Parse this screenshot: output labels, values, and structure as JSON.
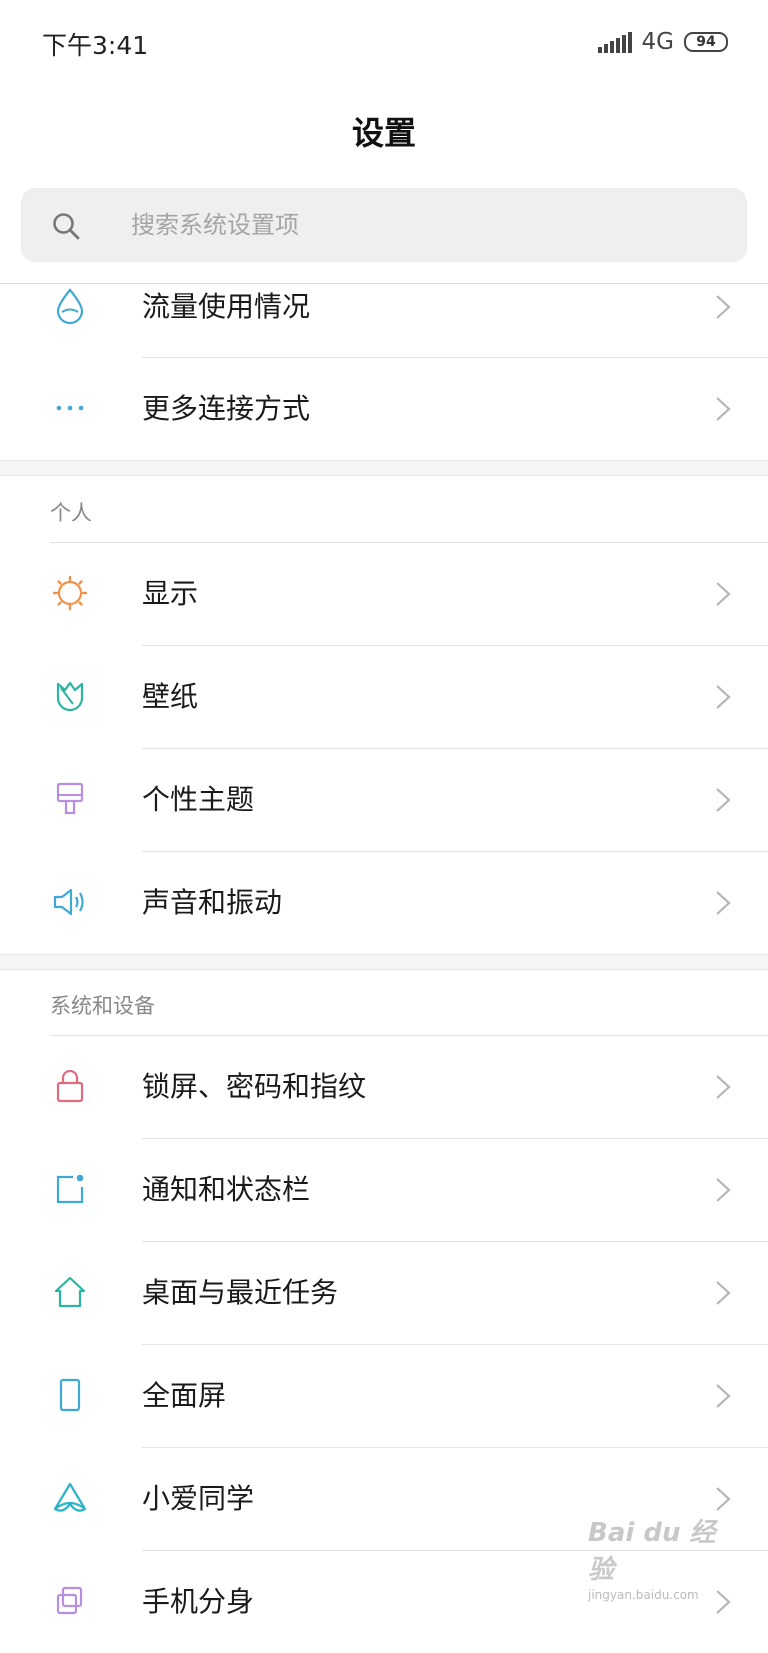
{
  "status": {
    "time": "下午3:41",
    "network": "4G",
    "battery": "94"
  },
  "title": "设置",
  "search": {
    "placeholder": "搜索系统设置项"
  },
  "items_top": [
    {
      "label": "流量使用情况",
      "icon": "water-drop-icon",
      "color": "#3fa9d6"
    },
    {
      "label": "更多连接方式",
      "icon": "more-dots-icon",
      "color": "#3fa9d6"
    }
  ],
  "section_personal": {
    "header": "个人",
    "items": [
      {
        "label": "显示",
        "icon": "sun-icon",
        "color": "#f0924a"
      },
      {
        "label": "壁纸",
        "icon": "tulip-icon",
        "color": "#2bb3a3"
      },
      {
        "label": "个性主题",
        "icon": "paintbrush-icon",
        "color": "#b88ee0"
      },
      {
        "label": "声音和振动",
        "icon": "speaker-icon",
        "color": "#3fa9d6"
      }
    ]
  },
  "section_system": {
    "header": "系统和设备",
    "items": [
      {
        "label": "锁屏、密码和指纹",
        "icon": "lock-icon",
        "color": "#e06d7e"
      },
      {
        "label": "通知和状态栏",
        "icon": "notification-icon",
        "color": "#3fa9d6"
      },
      {
        "label": "桌面与最近任务",
        "icon": "home-icon",
        "color": "#2bb3a3"
      },
      {
        "label": "全面屏",
        "icon": "phone-icon",
        "color": "#3fa9d6"
      },
      {
        "label": "小爱同学",
        "icon": "xiaoai-icon",
        "color": "#2bb3c9"
      },
      {
        "label": "手机分身",
        "icon": "second-space-icon",
        "color": "#b88ee0"
      }
    ]
  },
  "watermark": {
    "text": "Bai du 经验",
    "sub": "jingyan.baidu.com"
  }
}
